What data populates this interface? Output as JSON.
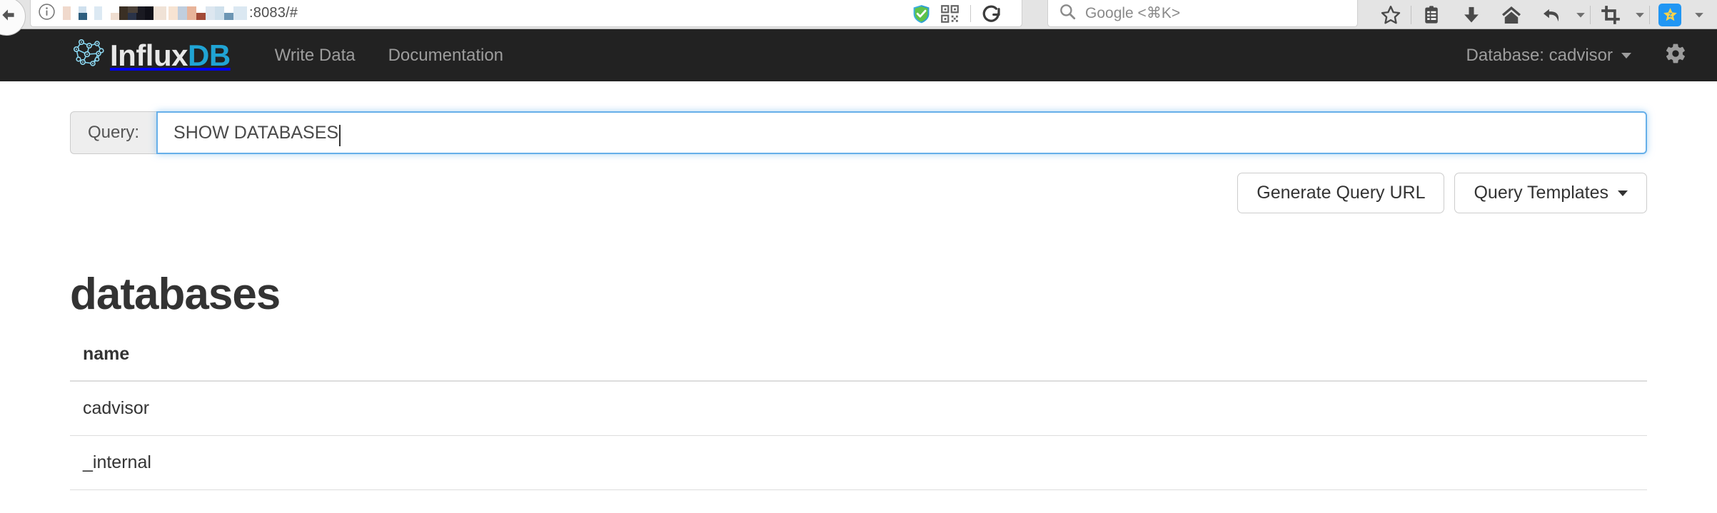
{
  "browser": {
    "url_suffix": ":8083/#",
    "url_redacted": true,
    "back_icon": "back-arrow-icon",
    "info_icon": "info-circle-icon",
    "shield_icon": "shield-check-icon",
    "qr_icon": "qr-code-icon",
    "reload_icon": "reload-icon",
    "search_placeholder": "Google <⌘K>",
    "search_icon": "search-icon",
    "toolbar_icons": [
      "star-bookmark-icon",
      "clipboard-list-icon",
      "download-arrow-icon",
      "home-icon",
      "undo-arrow-icon",
      "chevron-down-icon",
      "crop-tool-icon",
      "chevron-down-icon",
      "star-extension-icon",
      "chevron-down-icon"
    ]
  },
  "navbar": {
    "brand_primary": "Influx",
    "brand_accent": "DB",
    "brand_logo_icon": "influxdb-molecule-logo",
    "links": [
      {
        "label": "Write Data"
      },
      {
        "label": "Documentation"
      }
    ],
    "database_selector": "Database: cadvisor",
    "settings_icon": "gear-icon",
    "background_color": "#222222",
    "accent_color": "#20a4d4"
  },
  "query": {
    "label": "Query:",
    "value": "SHOW DATABASES",
    "placeholder": "",
    "focused": true,
    "focus_color": "#66afe9"
  },
  "buttons": {
    "generate_query_url": "Generate Query URL",
    "query_templates": "Query Templates"
  },
  "results": {
    "title": "databases",
    "columns": [
      "name"
    ],
    "rows": [
      [
        "cadvisor"
      ],
      [
        "_internal"
      ]
    ]
  }
}
